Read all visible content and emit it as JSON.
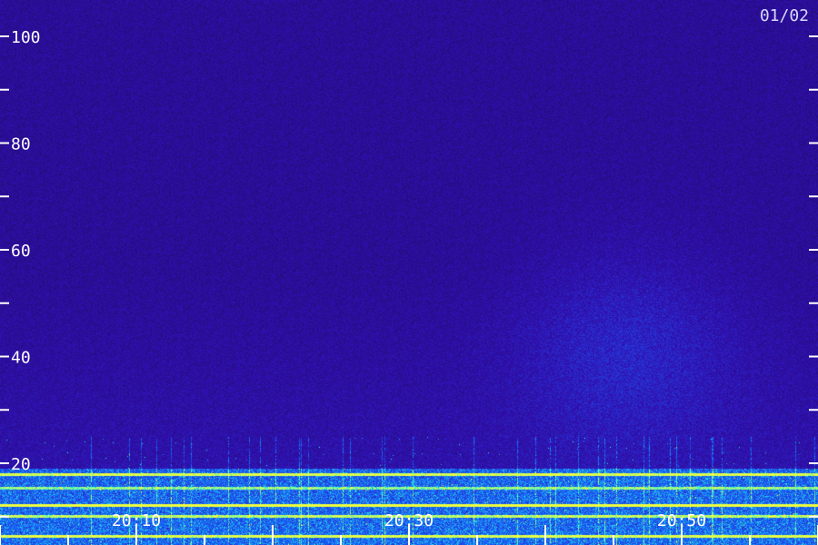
{
  "date_label": "01/02",
  "chart_data": {
    "type": "heatmap",
    "title": "",
    "xlabel": "",
    "ylabel": "",
    "ylim": [
      20,
      100
    ],
    "y_ticks_labeled": [
      {
        "value": 20,
        "label": "20"
      },
      {
        "value": 40,
        "label": "40"
      },
      {
        "value": 60,
        "label": "60"
      },
      {
        "value": 80,
        "label": "80"
      },
      {
        "value": 100,
        "label": "100"
      }
    ],
    "y_ticks_minor": [
      30,
      50,
      70,
      90
    ],
    "x_ticks_labeled": [
      {
        "value": "20:10",
        "label": "20:10"
      },
      {
        "value": "20:30",
        "label": "20:30"
      },
      {
        "value": "20:50",
        "label": "20:50"
      }
    ],
    "colors": {
      "background": "#1e0c4a",
      "low": "#3410a8",
      "mid": "#1a60ff",
      "high": "#30ffd0",
      "peak": "#f0ff40"
    },
    "grid": false
  }
}
